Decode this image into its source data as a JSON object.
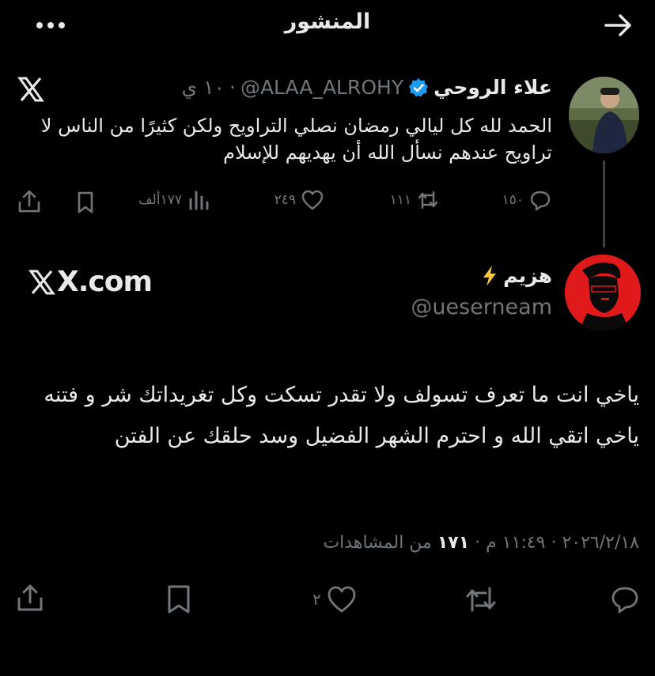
{
  "header": {
    "title": "المنشور",
    "back_icon": "arrow-right-icon",
    "more_icon": "more-horizontal-icon"
  },
  "parent_tweet": {
    "name": "علاء الروحي",
    "handle": "@ALAA_ALROHY",
    "time": "١٠ ي",
    "body": "الحمد لله كل ليالي رمضان نصلي التراويح ولكن كثيرًا من الناس لا تراويح عندهم نسأل الله أن يهديهم للإسلام",
    "stats": {
      "replies": "١٥٠",
      "retweets": "١١١",
      "likes": "٢٤٩",
      "views": "١٧٧ألف"
    }
  },
  "main_tweet": {
    "name": "هزيم",
    "handle": "@ueserneam",
    "watermark": "X.com",
    "body_lines": [
      "ياخي انت ما تعرف تسولف ولا تقدر تسكت وكل تغريداتك شر و فتنه",
      "ياخي اتقي الله و احترم الشهر الفضيل وسد حلقك عن الفتن"
    ],
    "meta": {
      "date": "٢٠٢٦/٢/١٨",
      "time": "١١:٤٩ م",
      "views_count": "١٧١",
      "views_label": "من المشاهدات",
      "separator": "·"
    },
    "stats": {
      "likes": "٢"
    }
  },
  "colors": {
    "background": "#000000",
    "text": "#e7e9ea",
    "muted": "#71767b",
    "verified": "#1d9bf0",
    "avatar_red": "#e01a1a",
    "bolt": "#f6c343"
  }
}
